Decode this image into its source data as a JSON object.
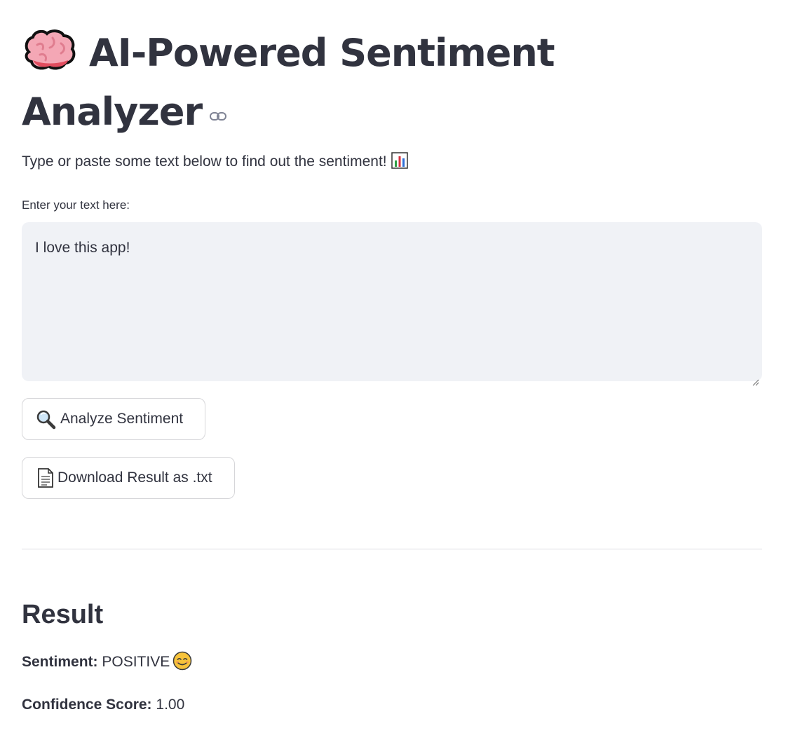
{
  "header": {
    "title": "AI-Powered Sentiment Analyzer",
    "title_icon": "brain-icon",
    "anchor_icon": "link-icon"
  },
  "intro": {
    "text": "Type or paste some text below to find out the sentiment!",
    "icon": "bar-chart-icon"
  },
  "input": {
    "label": "Enter your text here:",
    "value": "I love this app!"
  },
  "actions": {
    "analyze_label": "Analyze Sentiment",
    "analyze_icon": "magnifier-icon",
    "download_label": "Download Result as .txt",
    "download_icon": "document-icon"
  },
  "result": {
    "heading": "Result",
    "sentiment_label": "Sentiment:",
    "sentiment_value": "POSITIVE",
    "sentiment_icon": "smiling-face-icon",
    "confidence_label": "Confidence Score:",
    "confidence_value": "1.00"
  },
  "colors": {
    "text": "#31333f",
    "input_bg": "#f0f2f6",
    "button_border": "#d6d6d9",
    "divider": "#dcdde1"
  }
}
